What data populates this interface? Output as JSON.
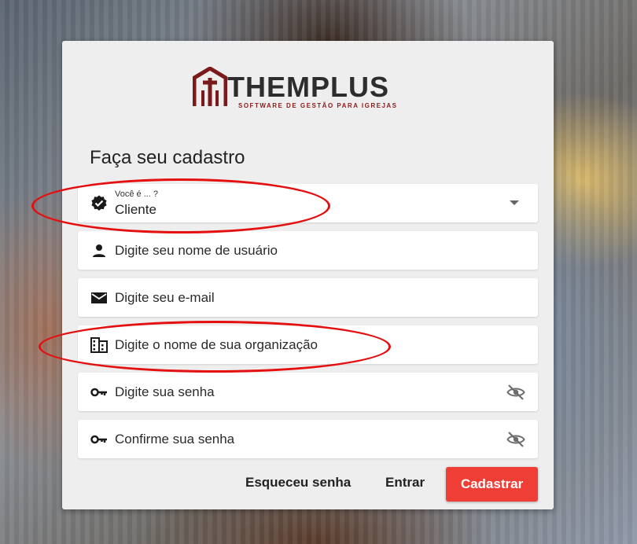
{
  "brand": {
    "name": "THEMPLUS",
    "tagline": "SOFTWARE DE GESTÃO PARA IGREJAS",
    "colors": {
      "mark": "#7a1a1a",
      "primary": "#ef3e36"
    }
  },
  "form": {
    "title": "Faça seu cadastro",
    "user_type": {
      "label": "Você é ... ?",
      "value": "Cliente",
      "icon": "verified-badge-icon"
    },
    "username": {
      "placeholder": "Digite seu nome de usuário",
      "icon": "person-icon"
    },
    "email": {
      "placeholder": "Digite seu e-mail",
      "icon": "mail-icon"
    },
    "organization": {
      "placeholder": "Digite o nome de sua organização",
      "icon": "building-icon"
    },
    "password": {
      "placeholder": "Digite sua senha",
      "icon": "key-icon"
    },
    "confirm_password": {
      "placeholder": "Confirme sua senha",
      "icon": "key-icon"
    }
  },
  "actions": {
    "forgot_label": "Esqueceu senha",
    "login_label": "Entrar",
    "register_label": "Cadastrar"
  }
}
